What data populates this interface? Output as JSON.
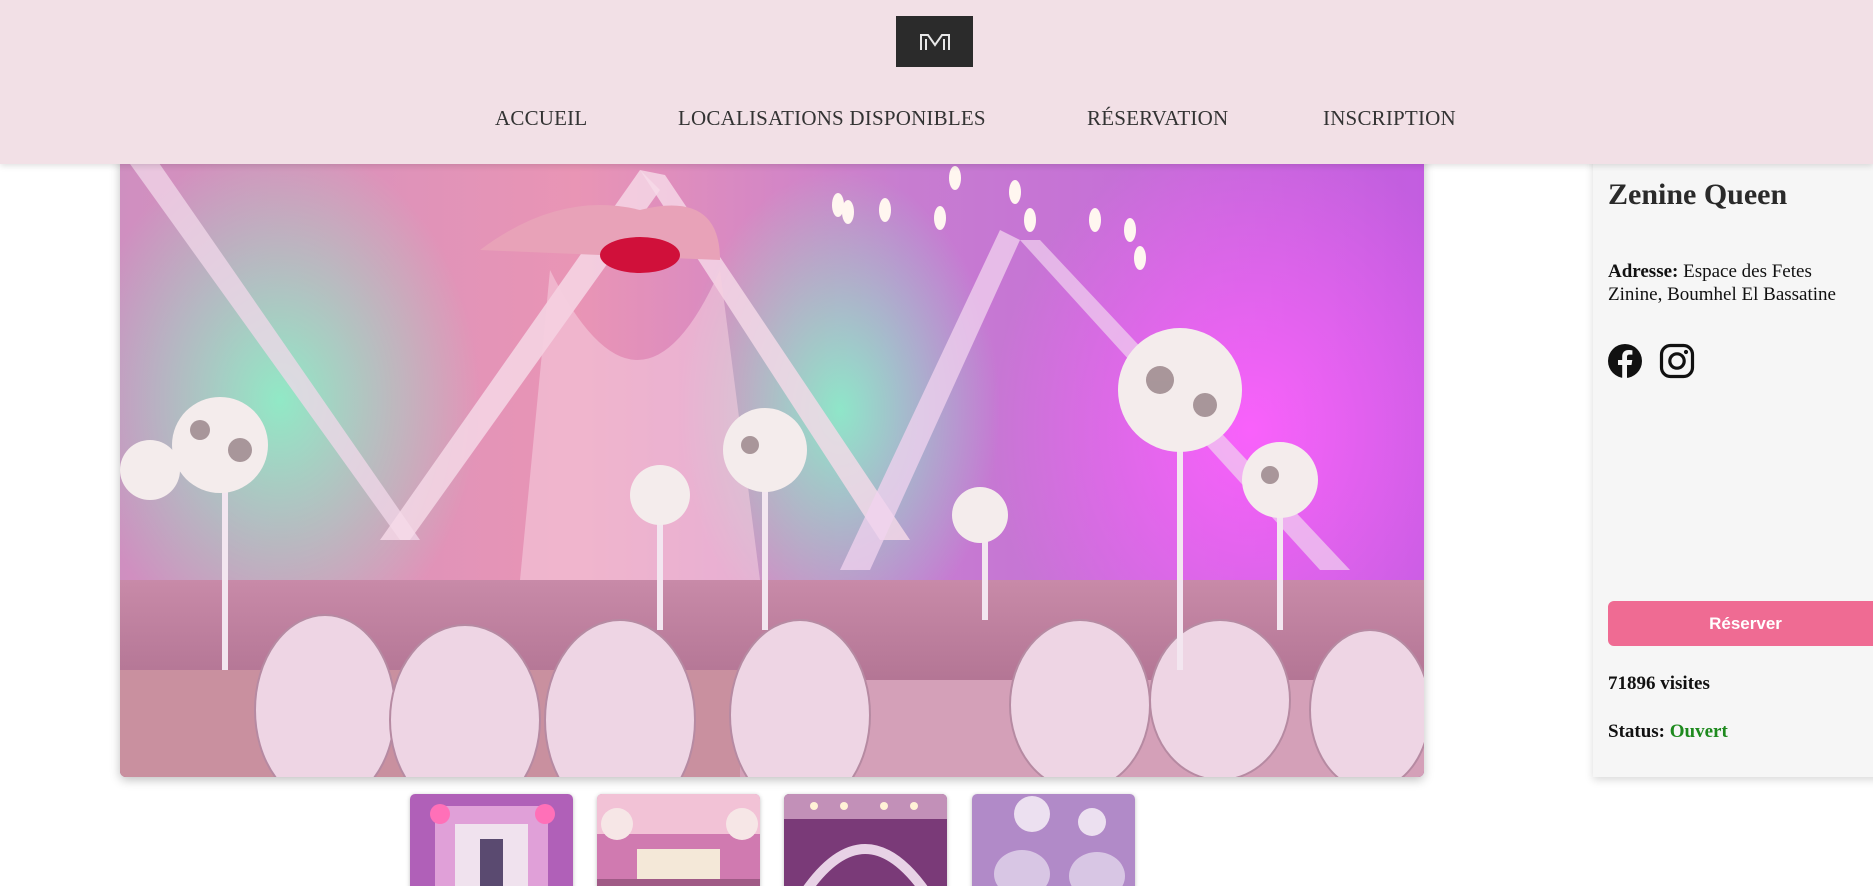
{
  "header": {
    "logo_icon": "m-monogram-logo",
    "nav": [
      {
        "label": "ACCUEIL"
      },
      {
        "label": "LOCALISATIONS DISPONIBLES"
      },
      {
        "label": "RÉSERVATION"
      },
      {
        "label": "INSCRIPTION"
      }
    ]
  },
  "gallery": {
    "main_image": "wedding-hall-decorated-tables",
    "thumbnails": [
      "hall-entrance-floral-arch",
      "bridal-stage",
      "hall-arches-lights",
      "tables-purple-lighting"
    ]
  },
  "venue": {
    "name": "Zenine Queen",
    "address_label": "Adresse:",
    "address_value": "Espace des Fetes Zinine, Boumhel El Bassatine",
    "social_icons": [
      "facebook-icon",
      "instagram-icon"
    ],
    "reserve_label": "Réserver",
    "visits": "71896 visites",
    "status_label": "Status:",
    "status_value": "Ouvert"
  },
  "colors": {
    "header_bg": "#f2e0e6",
    "button": "#ef6b93",
    "status_open": "#1e8a1e",
    "logo_bg": "#2b2b2b"
  }
}
